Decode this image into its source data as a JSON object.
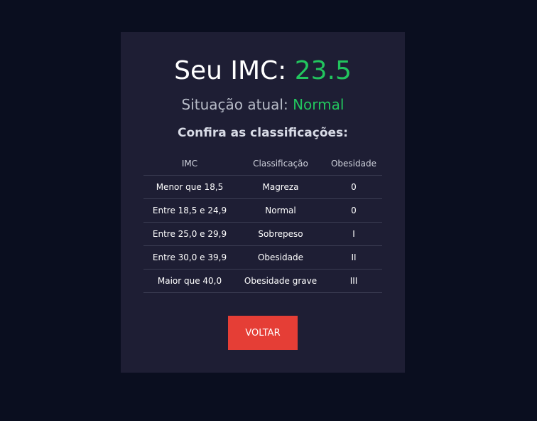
{
  "result": {
    "title_label": "Seu IMC:",
    "imc_value": "23.5",
    "situation_label": "Situação atual:",
    "situation_value": "Normal",
    "value_color": "#22c55e"
  },
  "classifications": {
    "heading": "Confira as classificações:",
    "columns": [
      "IMC",
      "Classificação",
      "Obesidade"
    ],
    "rows": [
      [
        "Menor que 18,5",
        "Magreza",
        "0"
      ],
      [
        "Entre 18,5 e 24,9",
        "Normal",
        "0"
      ],
      [
        "Entre 25,0 e 29,9",
        "Sobrepeso",
        "I"
      ],
      [
        "Entre 30,0 e 39,9",
        "Obesidade",
        "II"
      ],
      [
        "Maior que 40,0",
        "Obesidade grave",
        "III"
      ]
    ]
  },
  "actions": {
    "back_label": "VOLTAR",
    "back_color": "#e53e36"
  }
}
